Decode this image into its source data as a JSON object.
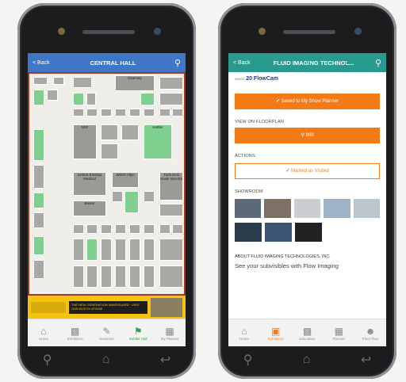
{
  "left_screen": {
    "back_label": "< Back",
    "title": "CENTRAL HALL",
    "map_labels": [
      "Diversey",
      "NSF",
      "Kettler",
      "Lenton Emergo Medical",
      "Welch Allyn",
      "Baxter",
      "Tuck et al Scale Spectra",
      "Holo",
      "Seraph"
    ],
    "banner_text": "THE NEW GENERATION WAVEGUARD · VISIT OUR BOOTH #T9208",
    "tabs": [
      {
        "label": "Home",
        "icon": "home-icon"
      },
      {
        "label": "Exhibitors",
        "icon": "building-icon"
      },
      {
        "label": "Sessions",
        "icon": "notepad-icon"
      },
      {
        "label": "Exhibit Hall",
        "icon": "map-pin-icon",
        "active": true
      },
      {
        "label": "My Planner",
        "icon": "calendar-icon"
      }
    ]
  },
  "right_screen": {
    "back_label": "< Back",
    "title": "FLUID IMAGING TECHNOL...",
    "logo_prefix": "SINCE",
    "logo_text": "20 FlowCam",
    "saved_button": "✔ Saved to My Show Planner",
    "floorplan_heading": "VIEW ON FLOORPLAN",
    "floorplan_button": "⚲ 960",
    "actions_heading": "ACTIONS",
    "visited_button": "✔ Marked as Visited",
    "showroom_heading": "SHOWROOM",
    "about_heading": "ABOUT FLUID IMAGING TECHNOLOGIES, INC.",
    "about_text": "See your subvisibles with Flow Imaging",
    "tabs": [
      {
        "label": "Home",
        "icon": "home-icon"
      },
      {
        "label": "Exhibitors",
        "icon": "cube-icon",
        "active": true
      },
      {
        "label": "Education",
        "icon": "building-icon"
      },
      {
        "label": "Planner",
        "icon": "calendar-icon"
      },
      {
        "label": "Floor Plan",
        "icon": "person-icon"
      }
    ]
  },
  "colors": {
    "left_header": "#3f76c6",
    "right_header": "#2a9a8e",
    "accent_orange": "#f47a17",
    "active_green": "#31a052",
    "map_green": "#7fd08f",
    "banner_yellow": "#f5c20e"
  }
}
